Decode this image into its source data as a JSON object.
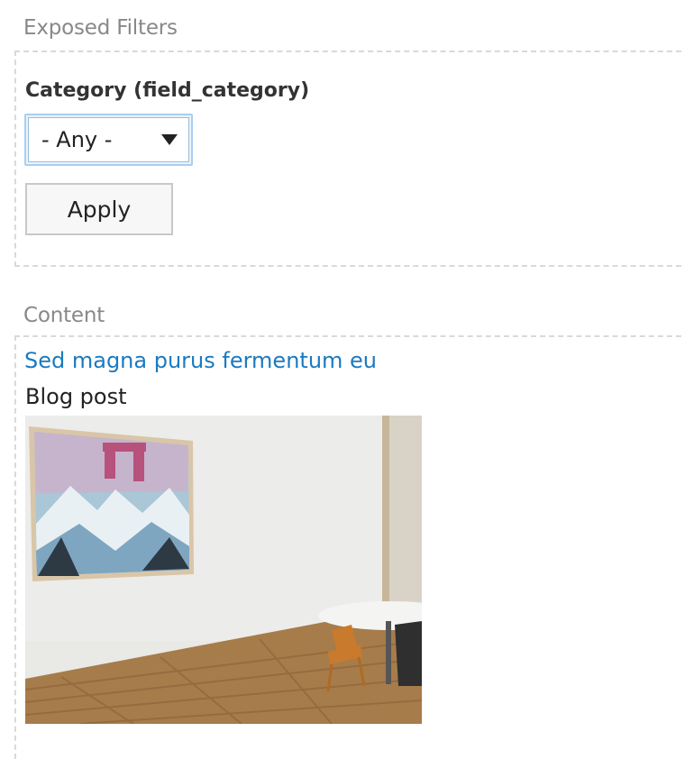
{
  "filters": {
    "title": "Exposed Filters",
    "category_label": "Category (field_category)",
    "category_selected": "- Any -",
    "apply_label": "Apply"
  },
  "content": {
    "title": "Content",
    "items": [
      {
        "title": "Sed magna purus fermentum eu",
        "type": "Blog post",
        "image": "office-room-photo"
      }
    ]
  },
  "colors": {
    "link": "#1a7ac0",
    "section_title": "#888888",
    "dashed_border": "#d9d9d9",
    "select_focus": "#a9cff0"
  }
}
